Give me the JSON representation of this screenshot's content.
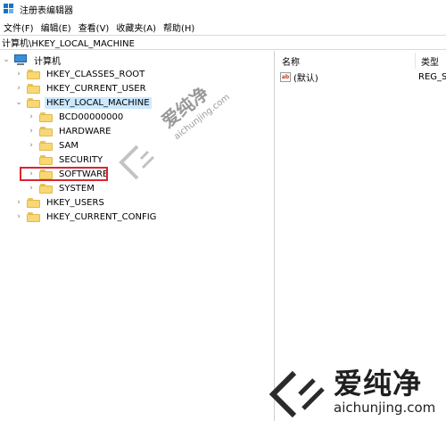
{
  "window": {
    "title": "注册表编辑器"
  },
  "menu": {
    "items": [
      "文件(F)",
      "编辑(E)",
      "查看(V)",
      "收藏夹(A)",
      "帮助(H)"
    ]
  },
  "address": {
    "path": "计算机\\HKEY_LOCAL_MACHINE"
  },
  "tree": {
    "root": "计算机",
    "hkcr": "HKEY_CLASSES_ROOT",
    "hkcu": "HKEY_CURRENT_USER",
    "hklm": "HKEY_LOCAL_MACHINE",
    "hklm_children": [
      "BCD00000000",
      "HARDWARE",
      "SAM",
      "SECURITY",
      "SOFTWARE",
      "SYSTEM"
    ],
    "hku": "HKEY_USERS",
    "hkcc": "HKEY_CURRENT_CONFIG",
    "selected": "HKEY_LOCAL_MACHINE",
    "highlighted": "SOFTWARE"
  },
  "list": {
    "columns": [
      "名称",
      "类型"
    ],
    "rows": [
      {
        "name": "(默认)",
        "type": "REG_S"
      }
    ]
  },
  "watermark": {
    "small_cn": "爱纯净",
    "small_en": "aichunjing.com",
    "large_cn": "爱纯净",
    "large_en": "aichunjing.com"
  },
  "colors": {
    "selection": "#cce8ff",
    "highlight_box": "#d9262e",
    "folder": "#f8d775"
  }
}
